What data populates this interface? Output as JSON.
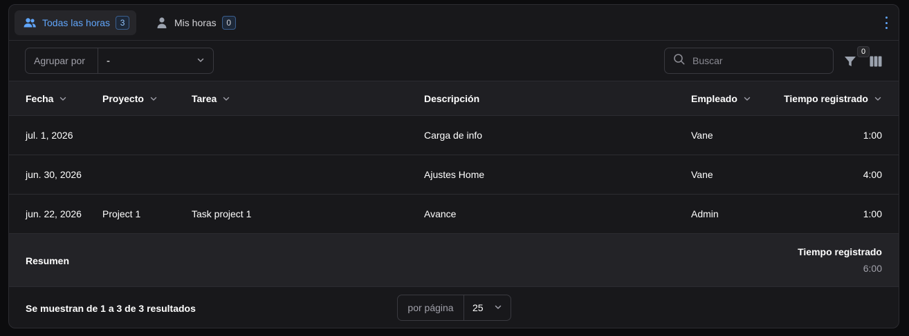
{
  "tabs": [
    {
      "label": "Todas las horas",
      "count": "3"
    },
    {
      "label": "Mis horas",
      "count": "0"
    }
  ],
  "toolbar": {
    "group_label": "Agrupar por",
    "group_value": "-",
    "search_placeholder": "Buscar",
    "filter_count": "0"
  },
  "table": {
    "headers": {
      "fecha": "Fecha",
      "proyecto": "Proyecto",
      "tarea": "Tarea",
      "descripcion": "Descripción",
      "empleado": "Empleado",
      "tiempo": "Tiempo registrado"
    },
    "rows": [
      {
        "fecha": "jul. 1, 2026",
        "proyecto": "",
        "tarea": "",
        "descripcion": "Carga de info",
        "empleado": "Vane",
        "tiempo": "1:00"
      },
      {
        "fecha": "jun. 30, 2026",
        "proyecto": "",
        "tarea": "",
        "descripcion": "Ajustes Home",
        "empleado": "Vane",
        "tiempo": "4:00"
      },
      {
        "fecha": "jun. 22, 2026",
        "proyecto": "Project 1",
        "tarea": "Task project 1",
        "descripcion": "Avance",
        "empleado": "Admin",
        "tiempo": "1:00"
      }
    ],
    "summary": {
      "label": "Resumen",
      "title": "Tiempo registrado",
      "value": "6:00"
    }
  },
  "footer": {
    "results_text": "Se muestran de 1 a 3 de 3 resultados",
    "per_page_label": "por página",
    "per_page_value": "25"
  },
  "colors": {
    "accent": "#60a5fa",
    "panel_bg": "#18181b",
    "header_bg": "#1f1f23",
    "summary_bg": "#232327"
  },
  "icons": {
    "tab_all": "users-icon",
    "tab_mine": "user-icon",
    "menu": "dots-vertical-icon",
    "search": "search-icon",
    "filter": "funnel-icon",
    "columns": "columns-icon",
    "chevron": "chevron-down-icon"
  }
}
